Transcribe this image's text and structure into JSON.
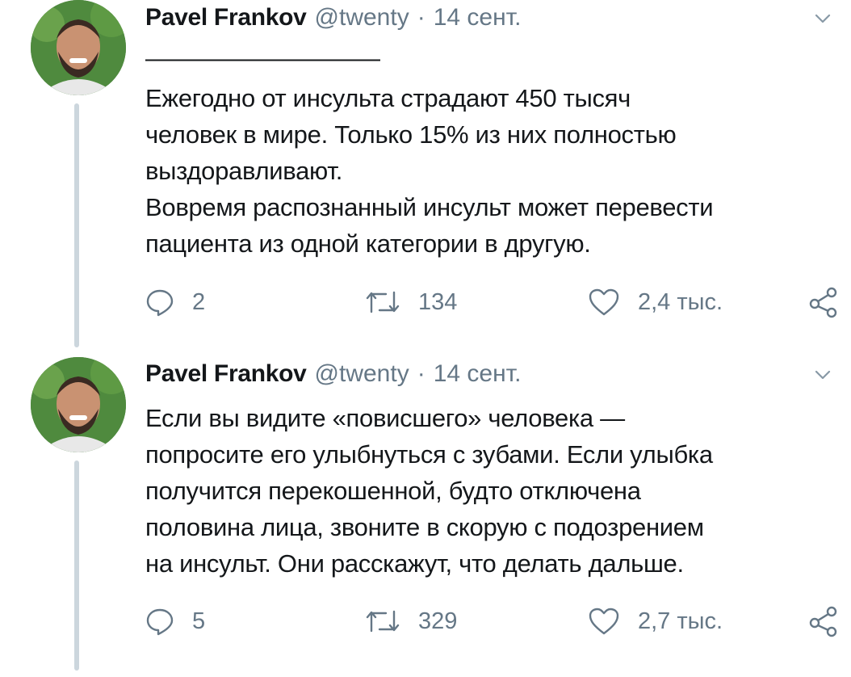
{
  "tweets": [
    {
      "author_name": "Pavel Frankov",
      "handle": "@twenty",
      "separator": "·",
      "date": "14 сент.",
      "divider": "——————————",
      "text": "Ежегодно от инсульта страдают 450 тысяч\nчеловек в мире. Только 15% из них полностью\nвыздоравливают.\nВовремя распознанный инсульт может перевести\nпациента из одной категории в другую.",
      "replies": "2",
      "retweets": "134",
      "likes": "2,4 тыс."
    },
    {
      "author_name": "Pavel Frankov",
      "handle": "@twenty",
      "separator": "·",
      "date": "14 сент.",
      "text": "Если вы видите «повисшего» человека —\nпопросите его улыбнуться с зубами. Если улыбка\nполучится перекошенной, будто отключена\nполовина лица, звоните в скорую с подозрением\nна инсульт. Они расскажут, что делать дальше.",
      "replies": "5",
      "retweets": "329",
      "likes": "2,7 тыс."
    }
  ],
  "icons": {
    "reply": "reply-icon",
    "retweet": "retweet-icon",
    "like": "heart-icon",
    "share": "share-icon",
    "menu": "chevron-down-icon"
  },
  "colors": {
    "text": "#14171a",
    "secondary": "#657786",
    "thread_line": "#ccd6dd"
  }
}
